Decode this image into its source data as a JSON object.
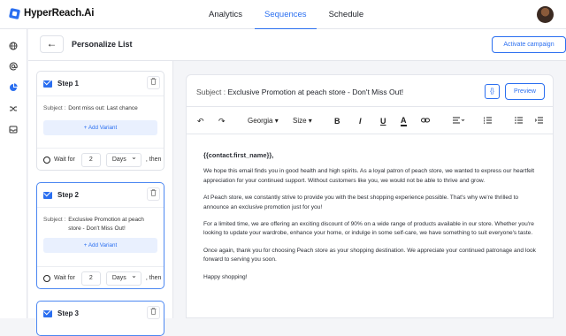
{
  "app": {
    "brand": "HyperReach.Ai"
  },
  "nav": {
    "tabs": [
      {
        "label": "Analytics"
      },
      {
        "label": "Sequences"
      },
      {
        "label": "Schedule"
      }
    ],
    "active": "Sequences"
  },
  "header": {
    "page_title": "Personalize List",
    "activate_label": "Activate campaign"
  },
  "rail": {
    "icons": [
      "globe-icon",
      "at-icon",
      "pie-chart-icon",
      "shuffle-icon",
      "inbox-icon"
    ]
  },
  "steps": [
    {
      "title": "Step 1",
      "subject_label": "Subject :",
      "subject": "Dont miss out: Last chance",
      "add_variant": "+ Add Variant",
      "wait_label": "Wait for",
      "wait_value": "2",
      "wait_unit": "Days",
      "then": ", then"
    },
    {
      "title": "Step 2",
      "subject_label": "Subject :",
      "subject": "Exclusive Promotion at peach store - Don't Miss Out!",
      "add_variant": "+ Add Variant",
      "wait_label": "Wait for",
      "wait_value": "2",
      "wait_unit": "Days",
      "then": ", then"
    },
    {
      "title": "Step 3"
    }
  ],
  "editor": {
    "subject_label": "Subject :",
    "subject": "Exclusive Promotion at peach store - Don't Miss Out!",
    "var_label": "{}",
    "preview_label": "Preview",
    "toolbar": {
      "font": "Georgia",
      "size": "Size"
    },
    "greeting": "{{contact.first_name}},",
    "paragraphs": [
      "We hope this email finds you in good health and high spirits. As a loyal patron of peach store, we wanted to express our heartfelt appreciation for your continued support. Without customers like you, we would not be able to thrive and grow.",
      "At Peach store, we constantly strive to provide you with the best shopping experience possible. That's why we're thrilled to announce an exclusive promotion just for you!",
      "For a limited time, we are offering an exciting discount of 90% on a wide range of products available in our store. Whether you're looking to update your wardrobe, enhance your home, or indulge in some self-care, we have something to suit everyone's taste.",
      "Once again, thank you for choosing Peach store as your shopping destination. We appreciate your continued patronage and look forward to serving you soon.",
      "Happy shopping!"
    ]
  },
  "colors": {
    "accent": "#2b6ff0"
  }
}
